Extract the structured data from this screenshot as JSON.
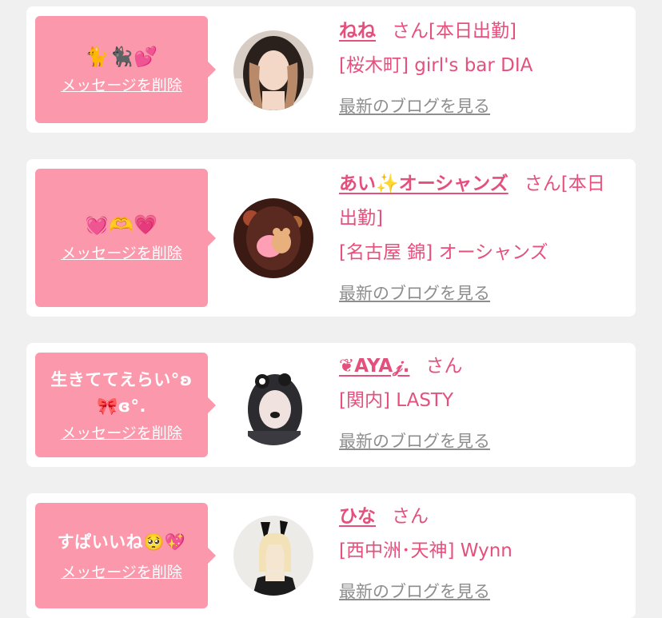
{
  "entries": [
    {
      "message": "🐈🐈‍⬛💕",
      "delete_label": "メッセージを削除",
      "name": "ねね",
      "san": "さん",
      "status": "[本日出勤]",
      "area_shop": "[桜木町] girl's bar DIA",
      "blog_label": "最新のブログを見る"
    },
    {
      "message": "💓🫶💗",
      "delete_label": "メッセージを削除",
      "name": "あい✨オーシャンズ",
      "san": "さん",
      "status": "[本日出勤]",
      "area_shop": "[名古屋 錦] オーシャンズ",
      "blog_label": "最新のブログを見る"
    },
    {
      "message_line1": "生きててえらい°ʚ",
      "message_line2": "🎀ɞ°.",
      "delete_label": "メッセージを削除",
      "name": "❦AYA𝒿.",
      "san": "さん",
      "area_shop": "[関内] LASTY",
      "blog_label": "最新のブログを見る"
    },
    {
      "message": "すぱいいね🥺💖",
      "delete_label": "メッセージを削除",
      "name": "ひな",
      "san": "さん",
      "area_shop": "[西中洲･天神] Wynn",
      "blog_label": "最新のブログを見る"
    }
  ]
}
